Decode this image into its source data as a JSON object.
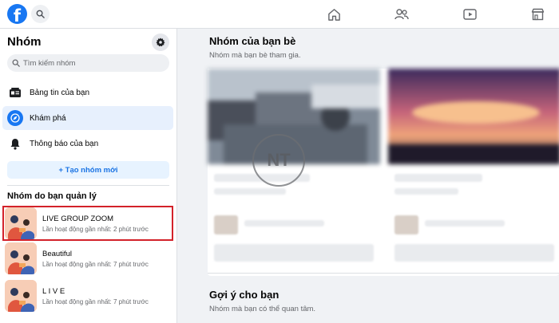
{
  "app": {
    "logo_letter": "f",
    "accent": "#1877f2"
  },
  "topbar": {
    "search_icon": "search-icon",
    "nav": [
      "home-icon",
      "friends-icon",
      "watch-icon",
      "marketplace-icon"
    ]
  },
  "sidebar": {
    "title": "Nhóm",
    "settings_icon": "gear-icon",
    "search": {
      "placeholder": "Tìm kiếm nhóm"
    },
    "menu": [
      {
        "label": "Bảng tin của bạn",
        "icon": "feed-icon"
      },
      {
        "label": "Khám phá",
        "icon": "compass-icon",
        "active": true
      },
      {
        "label": "Thông báo của bạn",
        "icon": "bell-icon"
      }
    ],
    "create_button": "+ Tạo nhóm mới",
    "managed_section": "Nhóm do bạn quản lý",
    "groups": [
      {
        "name": "LIVE GROUP ZOOM",
        "meta": "Lần hoạt động gần nhất: 2 phút trước",
        "highlighted": true
      },
      {
        "name": "Beautiful",
        "meta": "Lần hoạt động gần nhất: 7 phút trước"
      },
      {
        "name": "L I V E",
        "meta": "Lần hoạt động gần nhất: 7 phút trước"
      }
    ]
  },
  "main": {
    "friends_groups": {
      "title": "Nhóm của bạn bè",
      "subtitle": "Nhóm mà bạn bè tham gia."
    },
    "suggestions": {
      "title": "Gợi ý cho bạn",
      "subtitle": "Nhóm mà bạn có thể quan tâm."
    },
    "watermark": "NT"
  }
}
